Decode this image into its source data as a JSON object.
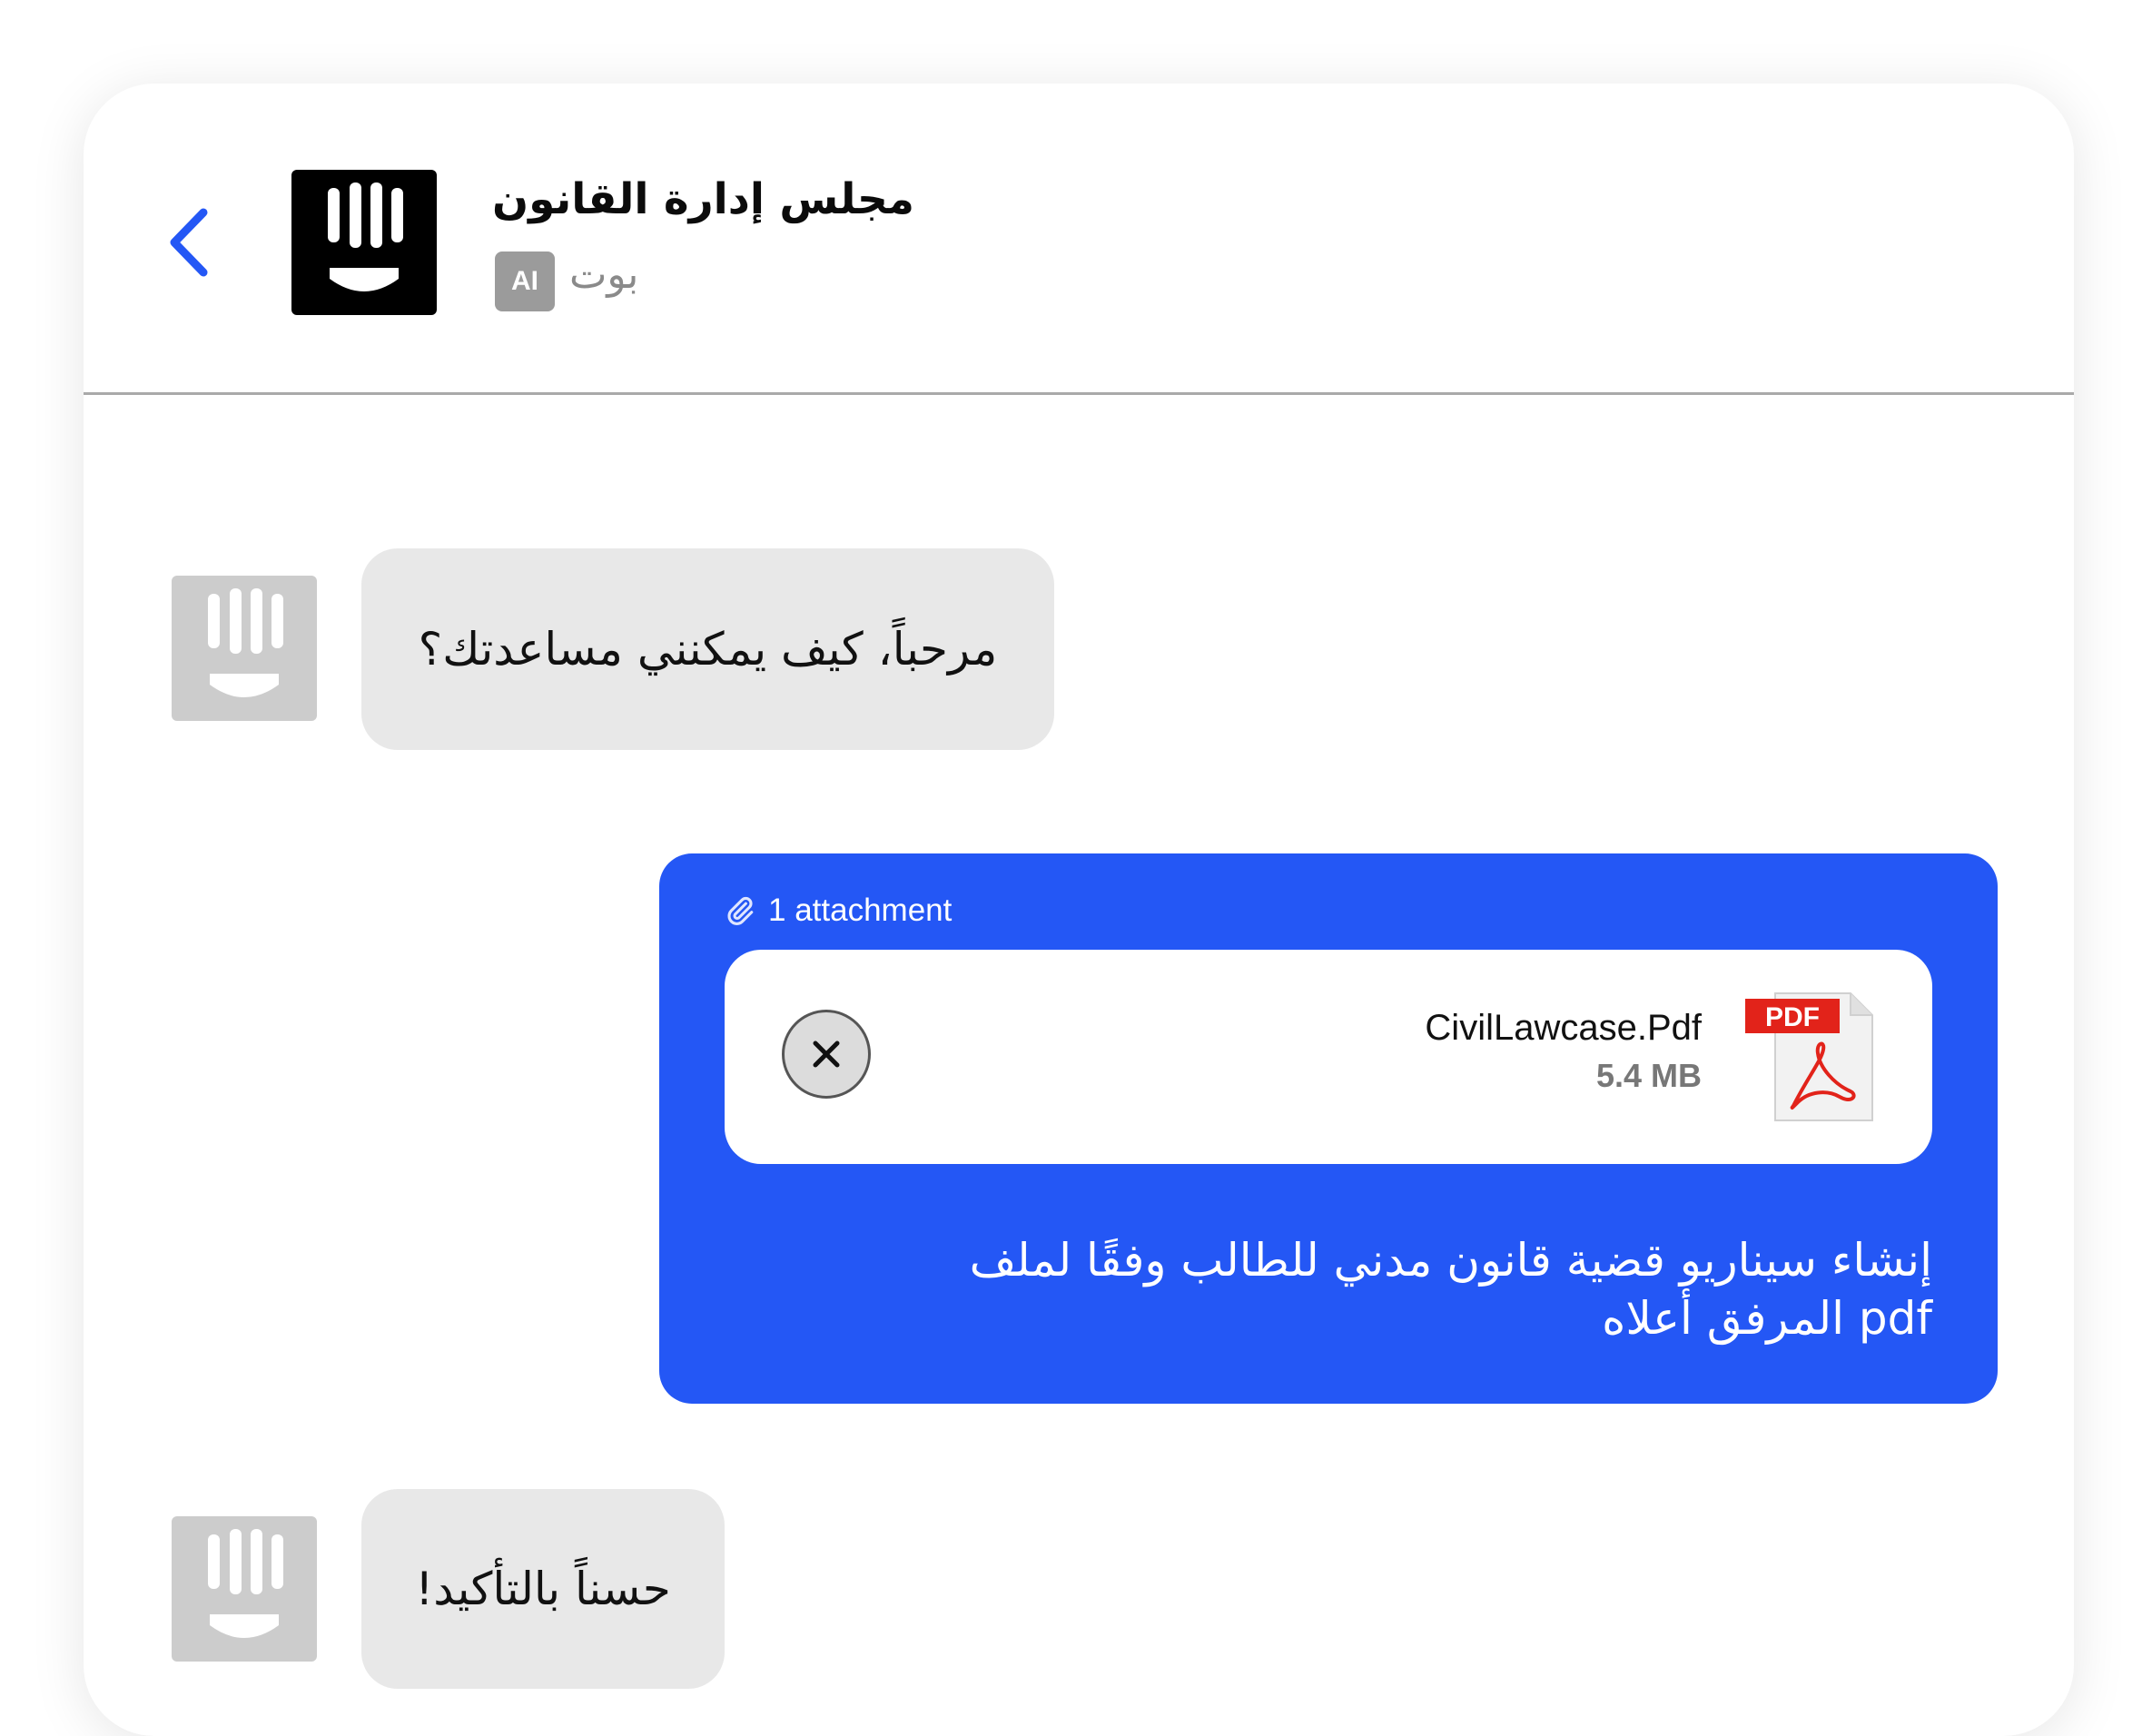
{
  "header": {
    "title": "مجلس إدارة القانون",
    "subtitle": "بوت",
    "badge": "AI"
  },
  "messages": [
    {
      "from": "bot",
      "text": "مرحباً، كيف يمكنني مساعدتك؟"
    },
    {
      "from": "user",
      "attachment_label": "1 attachment",
      "file_name": "CivilLawcase.Pdf",
      "file_size": "5.4 MB",
      "file_type_label": "PDF",
      "text_line1": "إنشاء سيناريو قضية قانون مدني للطالب وفقًا لملف",
      "text_line2": "pdf المرفق أعلاه"
    },
    {
      "from": "bot",
      "text": "حسناً بالتأكيد!"
    }
  ],
  "colors": {
    "accent": "#2457f5",
    "bot_bubble": "#e8e8e8",
    "avatar_bg": "#cccccc",
    "pdf_red": "#e2231a"
  },
  "icons": {
    "back": "chevron-left-icon",
    "logo": "bot-logo-icon",
    "attachment": "paperclip-icon",
    "remove": "close-icon",
    "file": "pdf-file-icon"
  }
}
